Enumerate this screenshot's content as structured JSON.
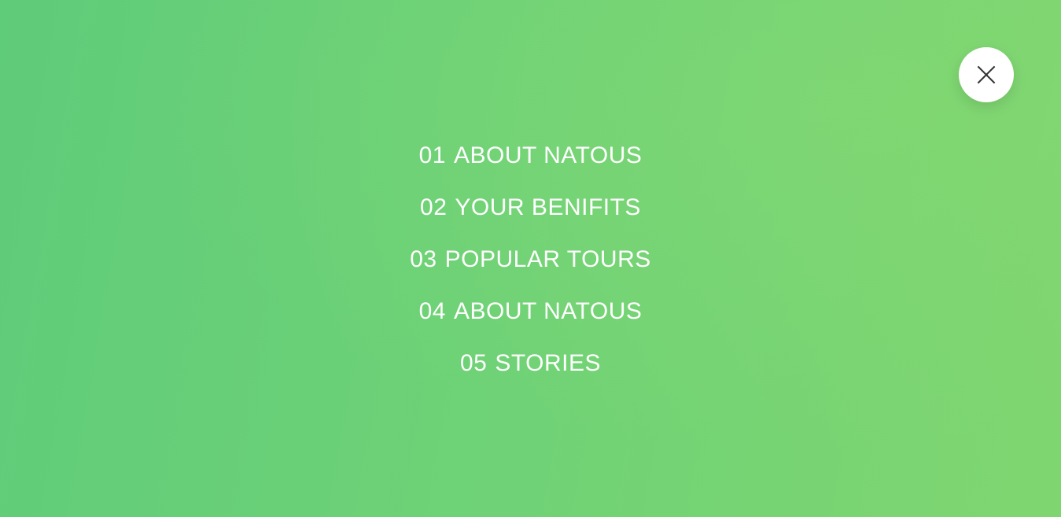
{
  "close_button": {
    "icon": "close-icon"
  },
  "navigation": {
    "items": [
      {
        "number": "01",
        "label": "ABOUT NATOUS"
      },
      {
        "number": "02",
        "label": "YOUR BENIFITS"
      },
      {
        "number": "03",
        "label": "POPULAR TOURS"
      },
      {
        "number": "04",
        "label": "ABOUT NATOUS"
      },
      {
        "number": "05",
        "label": "STORIES"
      }
    ]
  },
  "colors": {
    "background_start": "#5fcc7a",
    "background_end": "#7fd670",
    "text": "#ffffff",
    "close_button_bg": "#ffffff",
    "close_icon": "#333333"
  }
}
